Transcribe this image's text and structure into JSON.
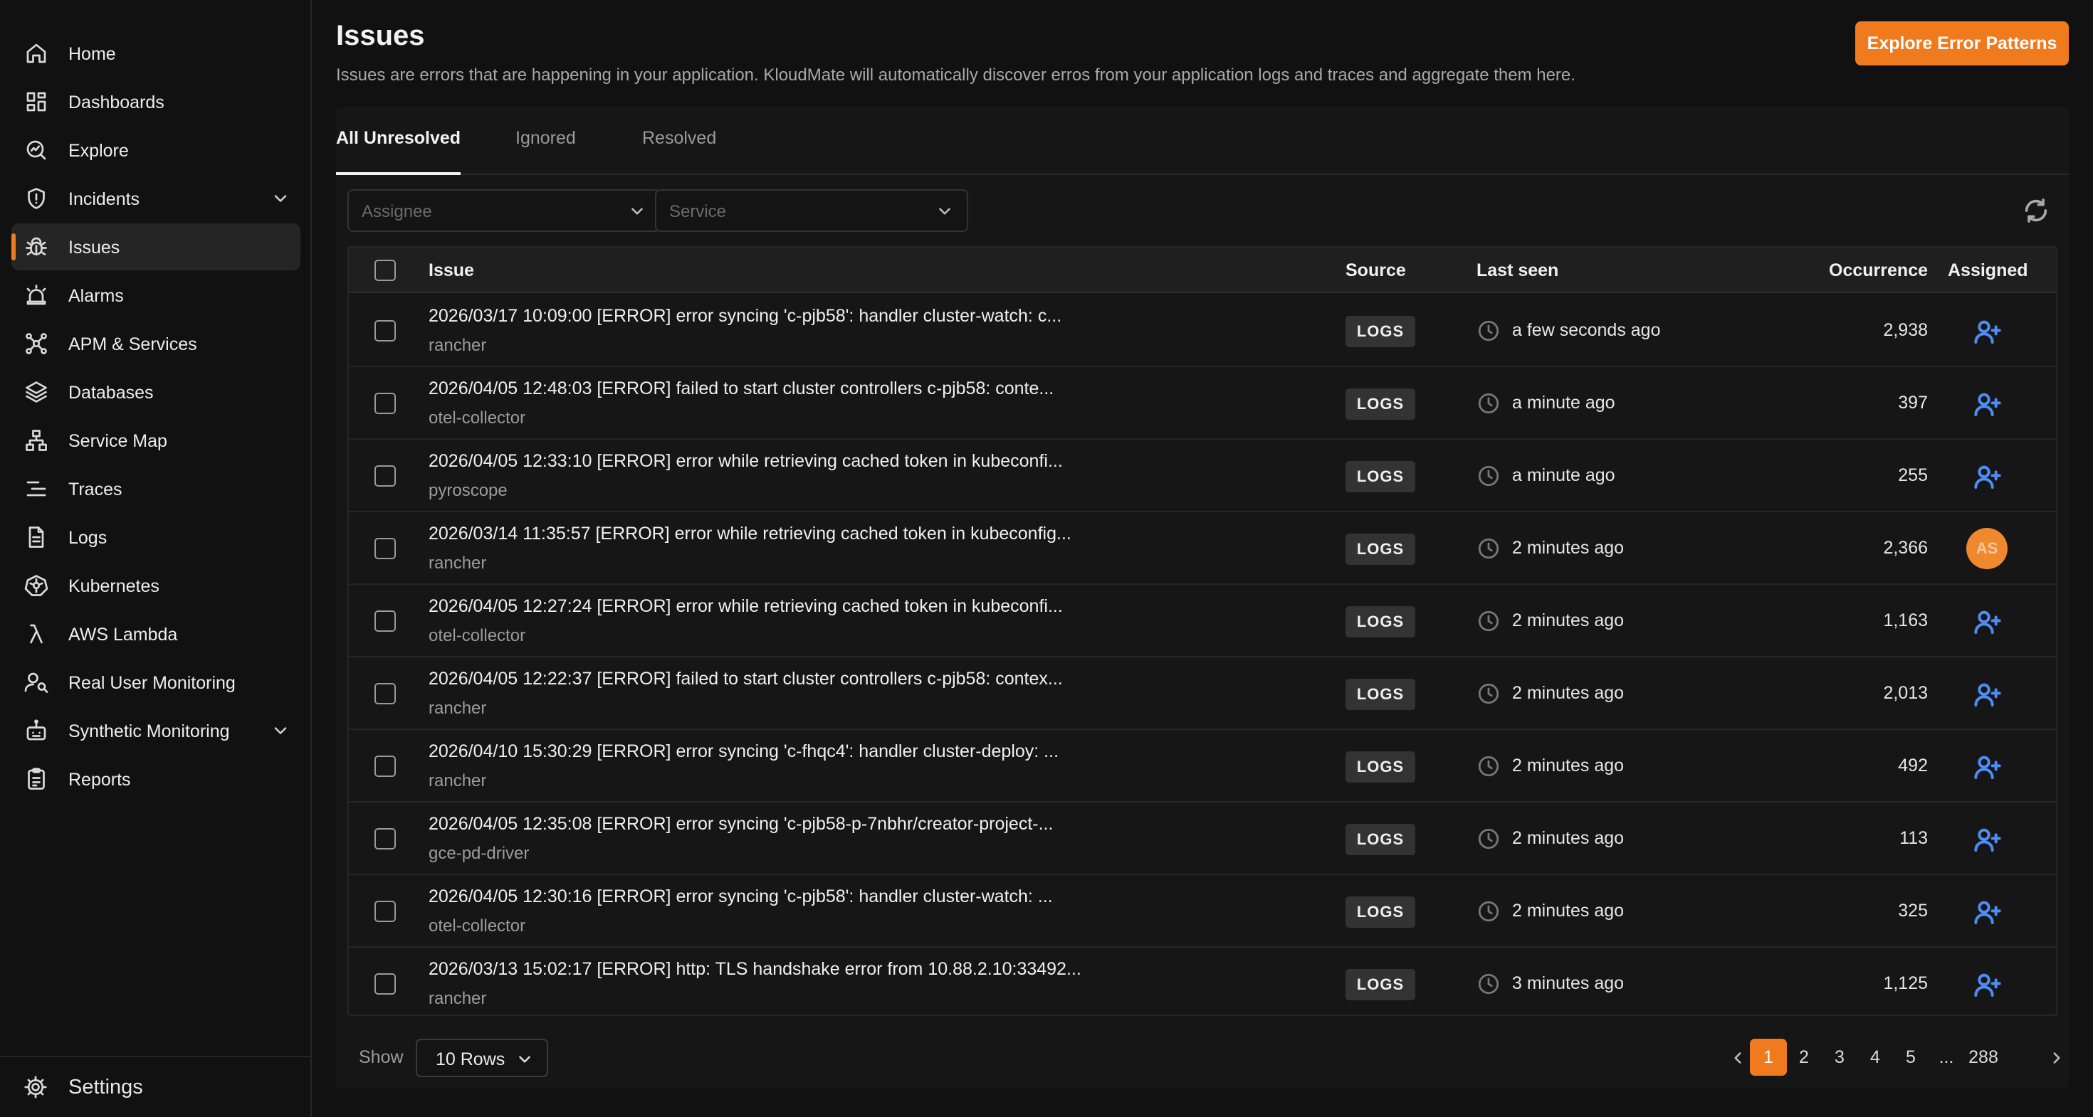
{
  "sidebar": {
    "items": [
      {
        "label": "Home",
        "icon": "home-icon"
      },
      {
        "label": "Dashboards",
        "icon": "dashboard-grid-icon"
      },
      {
        "label": "Explore",
        "icon": "explore-chart-icon"
      },
      {
        "label": "Incidents",
        "icon": "shield-alert-icon",
        "expandable": true
      },
      {
        "label": "Issues",
        "icon": "bug-icon",
        "active": true
      },
      {
        "label": "Alarms",
        "icon": "alarm-siren-icon"
      },
      {
        "label": "APM & Services",
        "icon": "network-nodes-icon"
      },
      {
        "label": "Databases",
        "icon": "layers-icon"
      },
      {
        "label": "Service Map",
        "icon": "sitemap-icon"
      },
      {
        "label": "Traces",
        "icon": "traces-lines-icon"
      },
      {
        "label": "Logs",
        "icon": "document-icon"
      },
      {
        "label": "Kubernetes",
        "icon": "kubernetes-icon"
      },
      {
        "label": "AWS Lambda",
        "icon": "lambda-icon"
      },
      {
        "label": "Real User Monitoring",
        "icon": "user-monitor-icon"
      },
      {
        "label": "Synthetic Monitoring",
        "icon": "robot-icon",
        "expandable": true
      },
      {
        "label": "Reports",
        "icon": "clipboard-icon"
      }
    ],
    "settings_label": "Settings"
  },
  "header": {
    "title": "Issues",
    "description": "Issues are errors that are happening in your application. KloudMate will automatically discover erros from your application logs and traces and aggregate them here.",
    "explore_button": "Explore Error Patterns"
  },
  "tabs": [
    {
      "label": "All Unresolved",
      "active": true
    },
    {
      "label": "Ignored",
      "active": false
    },
    {
      "label": "Resolved",
      "active": false
    }
  ],
  "filters": {
    "assignee_placeholder": "Assignee",
    "service_placeholder": "Service"
  },
  "table": {
    "columns": {
      "issue": "Issue",
      "source": "Source",
      "last_seen": "Last seen",
      "occurrence": "Occurrence",
      "assigned": "Assigned"
    },
    "rows": [
      {
        "title": "2026/03/17 10:09:00 [ERROR] error syncing 'c-pjb58': handler cluster-watch: c...",
        "service": "rancher",
        "source": "LOGS",
        "last_seen": "a few seconds ago",
        "occurrence": "2,938",
        "assigned": null
      },
      {
        "title": "2026/04/05 12:48:03 [ERROR] failed to start cluster controllers c-pjb58: conte...",
        "service": "otel-collector",
        "source": "LOGS",
        "last_seen": "a minute ago",
        "occurrence": "397",
        "assigned": null
      },
      {
        "title": "2026/04/05 12:33:10 [ERROR] error while retrieving cached token in kubeconfi...",
        "service": "pyroscope",
        "source": "LOGS",
        "last_seen": "a minute ago",
        "occurrence": "255",
        "assigned": null
      },
      {
        "title": "2026/03/14 11:35:57 [ERROR] error while retrieving cached token in kubeconfig...",
        "service": "rancher",
        "source": "LOGS",
        "last_seen": "2 minutes ago",
        "occurrence": "2,366",
        "assigned": "AS"
      },
      {
        "title": "2026/04/05 12:27:24 [ERROR] error while retrieving cached token in kubeconfi...",
        "service": "otel-collector",
        "source": "LOGS",
        "last_seen": "2 minutes ago",
        "occurrence": "1,163",
        "assigned": null
      },
      {
        "title": "2026/04/05 12:22:37 [ERROR] failed to start cluster controllers c-pjb58: contex...",
        "service": "rancher",
        "source": "LOGS",
        "last_seen": "2 minutes ago",
        "occurrence": "2,013",
        "assigned": null
      },
      {
        "title": "2026/04/10 15:30:29 [ERROR] error syncing 'c-fhqc4': handler cluster-deploy: ...",
        "service": "rancher",
        "source": "LOGS",
        "last_seen": "2 minutes ago",
        "occurrence": "492",
        "assigned": null
      },
      {
        "title": "2026/04/05 12:35:08 [ERROR] error syncing 'c-pjb58-p-7nbhr/creator-project-...",
        "service": "gce-pd-driver",
        "source": "LOGS",
        "last_seen": "2 minutes ago",
        "occurrence": "113",
        "assigned": null
      },
      {
        "title": "2026/04/05 12:30:16 [ERROR] error syncing 'c-pjb58': handler cluster-watch: ...",
        "service": "otel-collector",
        "source": "LOGS",
        "last_seen": "2 minutes ago",
        "occurrence": "325",
        "assigned": null
      },
      {
        "title": "2026/03/13 15:02:17 [ERROR] http: TLS handshake error from 10.88.2.10:33492...",
        "service": "rancher",
        "source": "LOGS",
        "last_seen": "3 minutes ago",
        "occurrence": "1,125",
        "assigned": null
      }
    ]
  },
  "footer": {
    "show_label": "Show",
    "rows_value": "10 Rows",
    "pages": [
      "1",
      "2",
      "3",
      "4",
      "5",
      "...",
      "288"
    ],
    "current_page": "1"
  },
  "colors": {
    "accent": "#f07a1e",
    "assign_icon": "#4d8df5",
    "background": "#111111"
  }
}
